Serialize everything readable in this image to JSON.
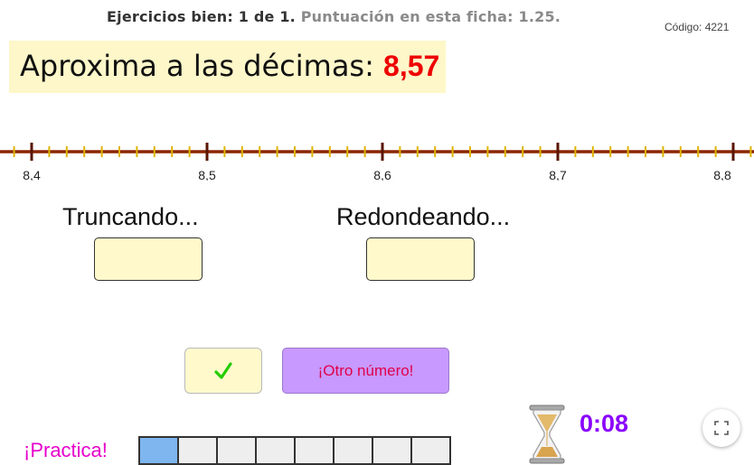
{
  "header": {
    "correct_label": "Ejercicios bien:",
    "correct_count": "1 de 1.",
    "score_label": "Puntuación en esta ficha:",
    "score_value": "1.25.",
    "code": "Código: 4221"
  },
  "prompt": {
    "text": "Aproxima a las décimas:",
    "number": "8,57"
  },
  "number_line": {
    "labels": [
      "8,4",
      "8,5",
      "8,6",
      "8,7",
      "8,8"
    ],
    "colors": {
      "line": "#8b2500",
      "minor_ticks": "#e0b400",
      "major_ticks": "#5a1500"
    }
  },
  "truncar": {
    "label": "Truncando...",
    "value": ""
  },
  "redondear": {
    "label": "Redondeando...",
    "value": ""
  },
  "buttons": {
    "check_icon": "check-mark-icon",
    "check_symbol": "✓",
    "other_label": "¡Otro número!"
  },
  "footer": {
    "practice_label": "¡Practica!",
    "progress": {
      "completed": 1,
      "total": 8
    },
    "timer": "0:08"
  }
}
